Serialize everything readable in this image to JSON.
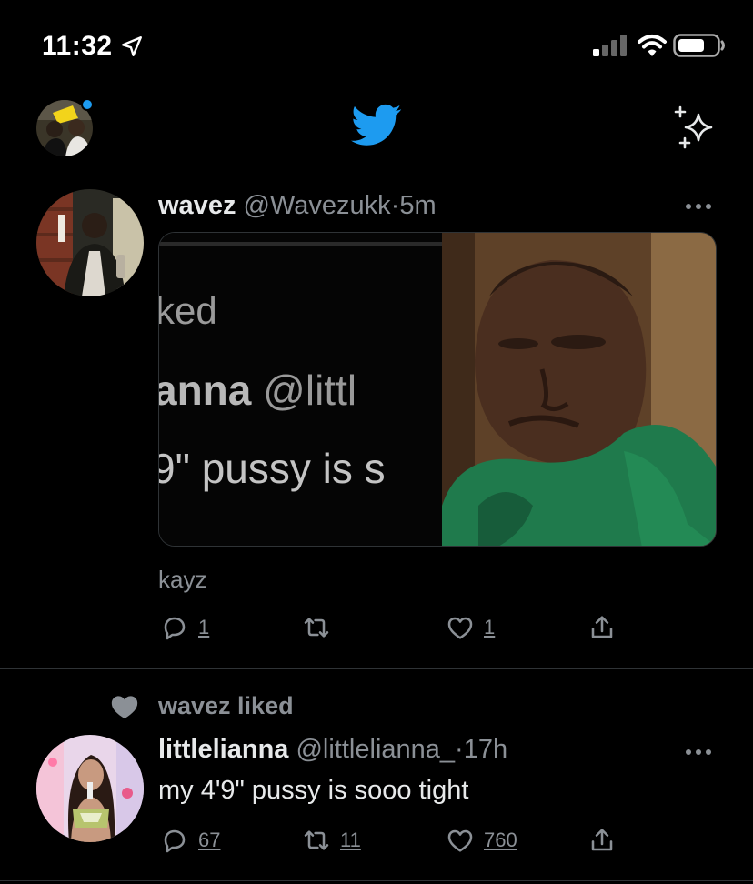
{
  "status_bar": {
    "time": "11:32"
  },
  "icons": {
    "location": "location-arrow-icon",
    "signal": "cellular-signal-icon",
    "wifi": "wifi-icon",
    "battery": "battery-icon",
    "logo": "twitter-bird-icon",
    "sparkle": "sparkle-icon",
    "more": "more-dots-icon",
    "reply": "reply-icon",
    "retweet": "retweet-icon",
    "like": "heart-icon",
    "share": "share-icon"
  },
  "colors": {
    "accent": "#1d9bf0",
    "background": "#000000",
    "secondary_text": "#8b9096",
    "primary_text": "#e7e9ea"
  },
  "tweet1": {
    "name": "wavez",
    "handle": "@Wavezukk",
    "separator": "·",
    "time": "5m",
    "media_crop_text": {
      "line1": "ked",
      "line2_bold": "anna",
      "line2_rest": " @littl",
      "line3": "9\" pussy is s"
    },
    "caption": "kayz",
    "reply_count": "1",
    "retweet_count": "",
    "like_count": "1"
  },
  "tweet2": {
    "context": "wavez liked",
    "name": "littlelianna",
    "handle": "@littlelianna_",
    "separator": "·",
    "time": "17h",
    "text": "my 4'9\" pussy is sooo tight",
    "reply_count": "67",
    "retweet_count": "11",
    "like_count": "760"
  }
}
